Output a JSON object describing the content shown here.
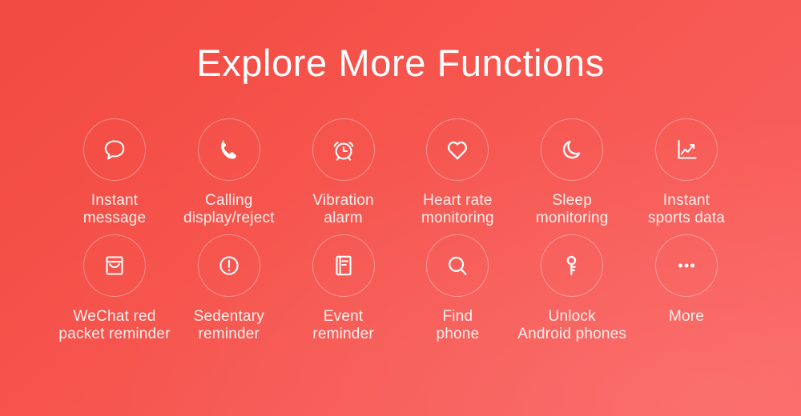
{
  "banner": {
    "title": "Explore More Functions",
    "background_color_start": "#f14a40",
    "background_color_end": "#fb6362",
    "text_color": "#ffffff",
    "ring_color": "rgba(255,255,255,0.38)"
  },
  "features": {
    "row1": [
      {
        "icon": "chat-bubble-icon",
        "label": "Instant\nmessage"
      },
      {
        "icon": "phone-handset-icon",
        "label": "Calling\ndisplay/reject"
      },
      {
        "icon": "alarm-clock-icon",
        "label": "Vibration\nalarm"
      },
      {
        "icon": "heart-icon",
        "label": "Heart rate\nmonitoring"
      },
      {
        "icon": "crescent-moon-icon",
        "label": "Sleep\nmonitoring"
      },
      {
        "icon": "line-chart-icon",
        "label": "Instant\nsports data"
      }
    ],
    "row2": [
      {
        "icon": "envelope-icon",
        "label": "WeChat red\npacket reminder"
      },
      {
        "icon": "exclamation-circle-icon",
        "label": "Sedentary\nreminder"
      },
      {
        "icon": "document-note-icon",
        "label": "Event\nreminder"
      },
      {
        "icon": "magnifier-icon",
        "label": "Find\nphone"
      },
      {
        "icon": "key-icon",
        "label": "Unlock\nAndroid phones"
      },
      {
        "icon": "ellipsis-icon",
        "label": "More"
      }
    ]
  }
}
